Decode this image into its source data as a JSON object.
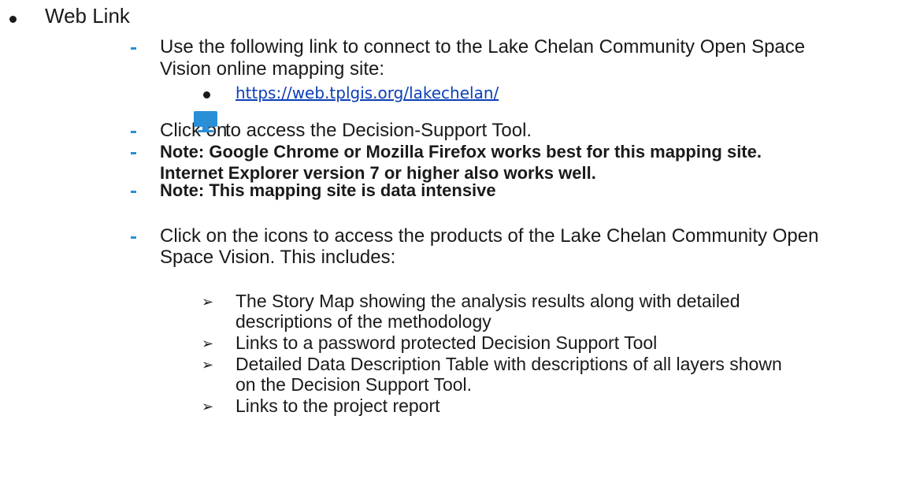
{
  "heading": "Web Link",
  "items": {
    "use_link_line1": "Use the following link to connect to the Lake Chelan Community Open Space",
    "use_link_line2": "Vision online mapping site:",
    "url": "https://web.tplgis.org/lakechelan/",
    "click_on": "Click on",
    "click_on_rest": "to access the Decision-Support Tool.",
    "note1_line1": "Note: Google Chrome or  Mozilla Firefox works best for this mapping site.",
    "note1_line2": "Internet Explorer version 7 or higher also works well.",
    "note2": "Note: This mapping site is data intensive",
    "icons_line1": "Click on the icons to access the products of the Lake Chelan Community Open",
    "icons_line2": "Space Vision. This includes:"
  },
  "includes": [
    {
      "line1": "The Story Map showing the analysis results along with detailed",
      "line2": "descriptions of the methodology"
    },
    {
      "line1": "Links to a password protected Decision Support Tool",
      "line2": ""
    },
    {
      "line1": "Detailed Data Description Table with descriptions of all layers shown",
      "line2": "on the Decision Support Tool."
    },
    {
      "line1": "Links to the project report",
      "line2": ""
    }
  ],
  "icons": {
    "monitor": "monitor-icon",
    "bullet": "bullet-dot",
    "dash": "dash-marker",
    "arrow": "arrow-bullet"
  },
  "colors": {
    "dash": "#2a8fd6",
    "link": "#0b3fb8",
    "monitor": "#2a8fd6"
  }
}
